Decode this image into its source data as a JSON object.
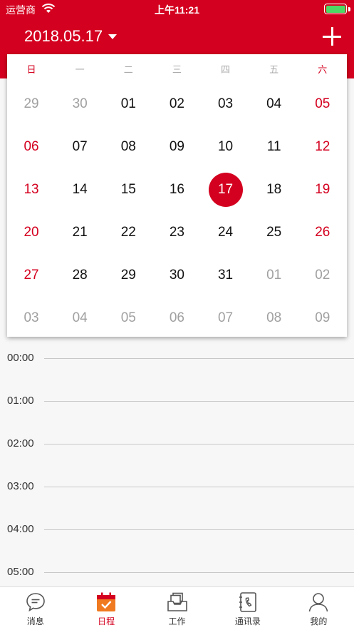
{
  "status_bar": {
    "carrier": "运营商",
    "time": "上午11:21"
  },
  "header": {
    "date": "2018.05.17",
    "accent_color": "#d4001f"
  },
  "calendar": {
    "weekdays": [
      "日",
      "一",
      "二",
      "三",
      "四",
      "五",
      "六"
    ],
    "weeks": [
      [
        {
          "d": "29",
          "t": "other"
        },
        {
          "d": "30",
          "t": "other"
        },
        {
          "d": "01",
          "t": "normal"
        },
        {
          "d": "02",
          "t": "normal"
        },
        {
          "d": "03",
          "t": "normal"
        },
        {
          "d": "04",
          "t": "normal"
        },
        {
          "d": "05",
          "t": "weekend"
        }
      ],
      [
        {
          "d": "06",
          "t": "weekend"
        },
        {
          "d": "07",
          "t": "normal"
        },
        {
          "d": "08",
          "t": "normal"
        },
        {
          "d": "09",
          "t": "normal"
        },
        {
          "d": "10",
          "t": "normal"
        },
        {
          "d": "11",
          "t": "normal"
        },
        {
          "d": "12",
          "t": "weekend"
        }
      ],
      [
        {
          "d": "13",
          "t": "weekend"
        },
        {
          "d": "14",
          "t": "normal"
        },
        {
          "d": "15",
          "t": "normal"
        },
        {
          "d": "16",
          "t": "normal"
        },
        {
          "d": "17",
          "t": "selected"
        },
        {
          "d": "18",
          "t": "normal"
        },
        {
          "d": "19",
          "t": "weekend"
        }
      ],
      [
        {
          "d": "20",
          "t": "weekend"
        },
        {
          "d": "21",
          "t": "normal"
        },
        {
          "d": "22",
          "t": "normal"
        },
        {
          "d": "23",
          "t": "normal"
        },
        {
          "d": "24",
          "t": "normal"
        },
        {
          "d": "25",
          "t": "normal"
        },
        {
          "d": "26",
          "t": "weekend"
        }
      ],
      [
        {
          "d": "27",
          "t": "weekend"
        },
        {
          "d": "28",
          "t": "normal"
        },
        {
          "d": "29",
          "t": "normal"
        },
        {
          "d": "30",
          "t": "normal"
        },
        {
          "d": "31",
          "t": "normal"
        },
        {
          "d": "01",
          "t": "other"
        },
        {
          "d": "02",
          "t": "other"
        }
      ],
      [
        {
          "d": "03",
          "t": "other"
        },
        {
          "d": "04",
          "t": "other"
        },
        {
          "d": "05",
          "t": "other"
        },
        {
          "d": "06",
          "t": "other"
        },
        {
          "d": "07",
          "t": "other"
        },
        {
          "d": "08",
          "t": "other"
        },
        {
          "d": "09",
          "t": "other"
        }
      ]
    ]
  },
  "timeline": {
    "hours": [
      "00:00",
      "01:00",
      "02:00",
      "03:00",
      "04:00",
      "05:00"
    ]
  },
  "tabbar": {
    "tabs": [
      {
        "label": "消息",
        "icon": "message-icon",
        "active": false
      },
      {
        "label": "日程",
        "icon": "schedule-icon",
        "active": true
      },
      {
        "label": "工作",
        "icon": "work-icon",
        "active": false
      },
      {
        "label": "通讯录",
        "icon": "contacts-icon",
        "active": false
      },
      {
        "label": "我的",
        "icon": "profile-icon",
        "active": false
      }
    ]
  }
}
